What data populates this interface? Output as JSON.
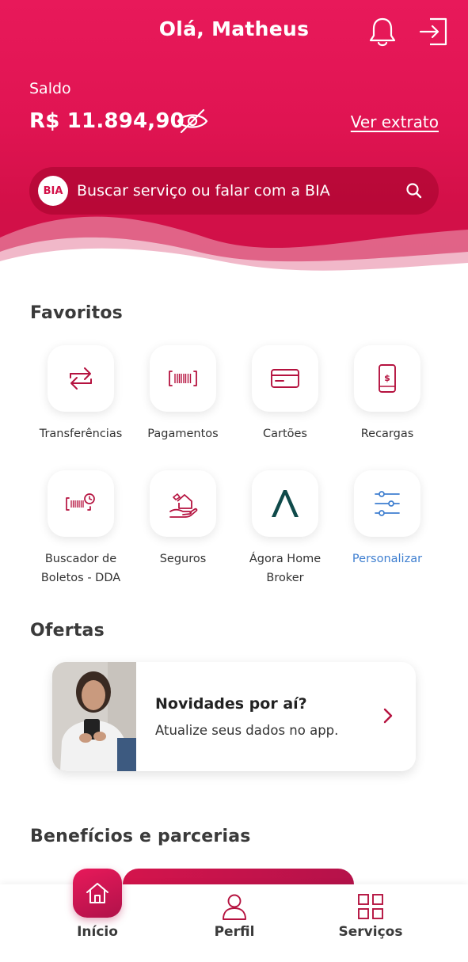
{
  "header": {
    "greeting": "Olá, Matheus",
    "balance_label": "Saldo",
    "balance_value": "R$ 11.894,90",
    "statement_link": "Ver extrato",
    "icons": [
      "bell-icon",
      "logout-icon",
      "eye-off-icon"
    ]
  },
  "search": {
    "badge": "BIA",
    "placeholder": "Buscar serviço ou falar com a BIA",
    "icon": "search-icon"
  },
  "favorites": {
    "title": "Favoritos",
    "items": [
      {
        "label": "Transferências",
        "icon": "transfer-arrows-icon"
      },
      {
        "label": "Pagamentos",
        "icon": "barcode-icon"
      },
      {
        "label": "Cartões",
        "icon": "card-icon"
      },
      {
        "label": "Recargas",
        "icon": "phone-recharge-icon"
      },
      {
        "label_line1": "Buscador de",
        "label_line2": "Boletos - DDA",
        "icon": "barcode-search-icon"
      },
      {
        "label": "Seguros",
        "icon": "insurance-hand-icon"
      },
      {
        "label_line1": "Ágora Home",
        "label_line2": "Broker",
        "icon": "agora-logo-icon"
      },
      {
        "label": "Personalizar",
        "icon": "sliders-icon"
      }
    ]
  },
  "offers": {
    "title": "Ofertas",
    "card": {
      "title": "Novidades por aí?",
      "subtitle": "Atualize seus dados no app."
    }
  },
  "benefits": {
    "title": "Benefícios e parcerias"
  },
  "bottom_nav": {
    "items": [
      {
        "label": "Início",
        "icon": "home-icon"
      },
      {
        "label": "Perfil",
        "icon": "person-icon"
      },
      {
        "label": "Serviços",
        "icon": "grid-icon"
      }
    ]
  },
  "colors": {
    "brand": "#e01452",
    "brand_dark": "#b0124a",
    "link_blue": "#3f7fd0",
    "icon_red": "#b5123f"
  }
}
